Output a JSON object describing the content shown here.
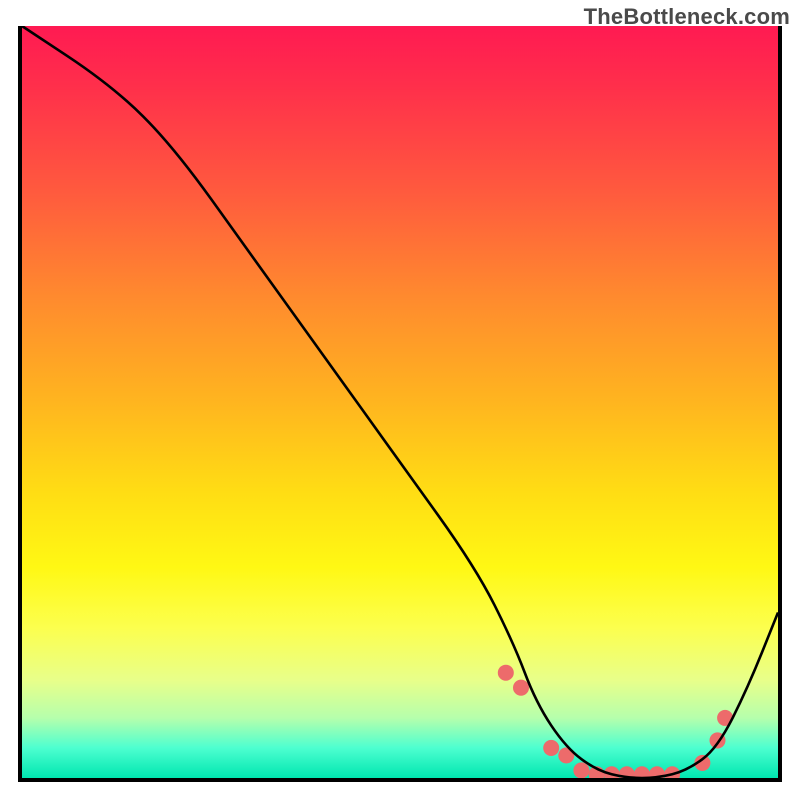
{
  "watermark": "TheBottleneck.com",
  "chart_data": {
    "type": "line",
    "title": "",
    "xlabel": "",
    "ylabel": "",
    "xlim": [
      0,
      100
    ],
    "ylim": [
      0,
      100
    ],
    "grid": false,
    "series": [
      {
        "name": "curve",
        "color": "#000000",
        "x": [
          0,
          12,
          20,
          30,
          40,
          50,
          60,
          65,
          68,
          72,
          76,
          80,
          84,
          88,
          92,
          96,
          100
        ],
        "y": [
          100,
          92,
          84,
          70,
          56,
          42,
          28,
          18,
          10,
          4,
          1,
          0,
          0,
          1,
          4,
          12,
          22
        ]
      }
    ],
    "markers": {
      "name": "highlight-dots",
      "color": "#ed6b6b",
      "radius": 8,
      "x": [
        64,
        66,
        70,
        72,
        74,
        76,
        78,
        80,
        82,
        84,
        86,
        90,
        92,
        93
      ],
      "y": [
        14,
        12,
        4,
        3,
        1,
        0.5,
        0.5,
        0.5,
        0.5,
        0.5,
        0.5,
        2,
        5,
        8
      ]
    },
    "background_gradient": {
      "direction": "vertical",
      "stops": [
        {
          "pos": 0.0,
          "color": "#ff1a52"
        },
        {
          "pos": 0.22,
          "color": "#ff5a3e"
        },
        {
          "pos": 0.5,
          "color": "#ffb51f"
        },
        {
          "pos": 0.72,
          "color": "#fff814"
        },
        {
          "pos": 0.92,
          "color": "#b6ffac"
        },
        {
          "pos": 1.0,
          "color": "#00e6b0"
        }
      ]
    }
  }
}
